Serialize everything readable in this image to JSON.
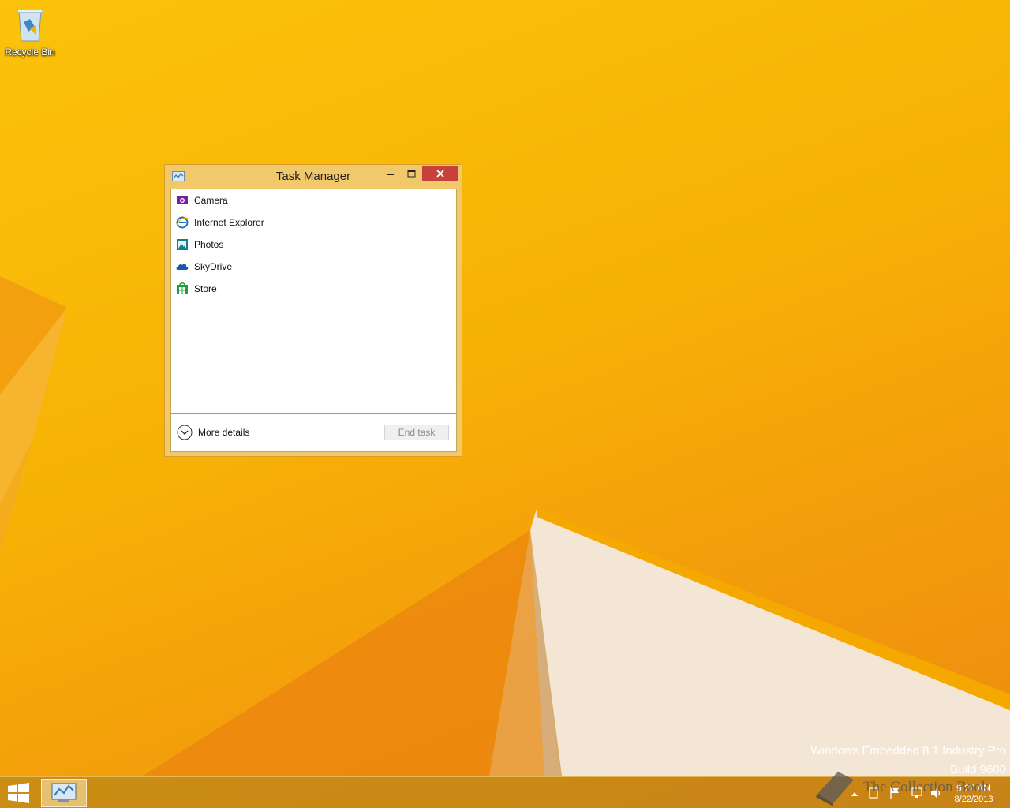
{
  "desktop": {
    "icons": [
      {
        "label": "Recycle Bin",
        "icon": "recycle-bin-icon"
      }
    ],
    "edition_line1": "Windows Embedded 8.1 Industry Pro",
    "edition_line2": "Build 9600"
  },
  "task_manager": {
    "title": "Task Manager",
    "apps": [
      {
        "label": "Camera",
        "icon": "camera-icon",
        "color": "#7a1f9e"
      },
      {
        "label": "Internet Explorer",
        "icon": "internet-explorer-icon",
        "color": "#1a74c6"
      },
      {
        "label": "Photos",
        "icon": "photos-icon",
        "color": "#0f7f8f"
      },
      {
        "label": "SkyDrive",
        "icon": "skydrive-icon",
        "color": "#1858a8"
      },
      {
        "label": "Store",
        "icon": "store-icon",
        "color": "#1f9e3b"
      }
    ],
    "more_details_label": "More details",
    "end_task_label": "End task"
  },
  "taskbar": {
    "clock_time": "9:27 AM",
    "clock_date": "8/22/2013",
    "watermark_text": "The Collection Book"
  },
  "colors": {
    "accent": "#f2b41a",
    "close_button": "#c7413a",
    "window_frame": "#f1c86a"
  }
}
